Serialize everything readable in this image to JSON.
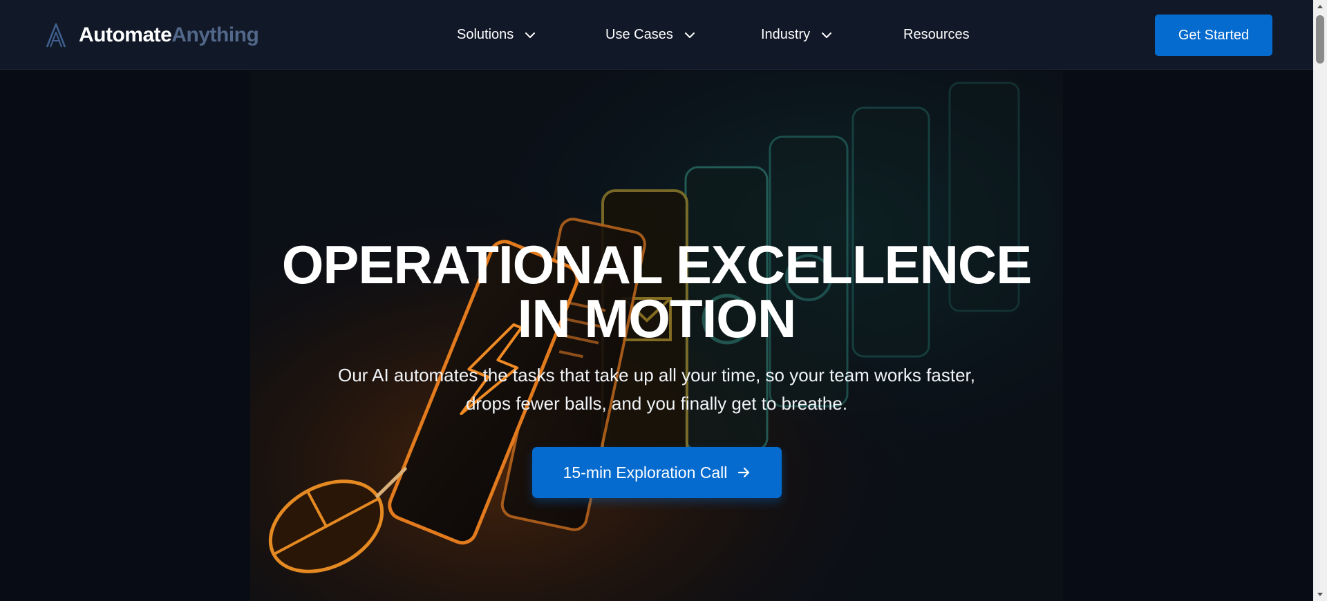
{
  "brand": {
    "name_part1": "Automate",
    "name_part2": "Anything",
    "logo_icon": "a-logo-icon"
  },
  "nav": {
    "items": [
      {
        "label": "Solutions",
        "has_dropdown": true
      },
      {
        "label": "Use Cases",
        "has_dropdown": true
      },
      {
        "label": "Industry",
        "has_dropdown": true
      },
      {
        "label": "Resources",
        "has_dropdown": false
      }
    ],
    "cta_label": "Get Started"
  },
  "hero": {
    "title": "OPERATIONAL EXCELLENCE IN MOTION",
    "subtitle": "Our AI automates the tasks that take up all your time, so your team works faster, drops fewer balls, and you finally get to breathe.",
    "cta_label": "15-min Exploration Call",
    "cta_icon": "arrow-right-icon"
  },
  "colors": {
    "header_bg": "#111827",
    "page_bg": "#080c14",
    "accent": "#056bcf",
    "brand_muted": "#52688a",
    "glow_orange": "#f08a24",
    "glow_teal": "#2d8c87"
  }
}
